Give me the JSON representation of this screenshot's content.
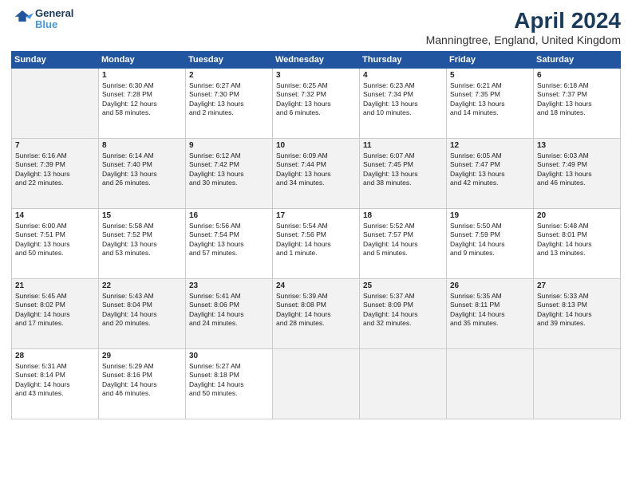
{
  "logo": {
    "line1": "General",
    "line2": "Blue"
  },
  "title": "April 2024",
  "location": "Manningtree, England, United Kingdom",
  "headers": [
    "Sunday",
    "Monday",
    "Tuesday",
    "Wednesday",
    "Thursday",
    "Friday",
    "Saturday"
  ],
  "weeks": [
    [
      {
        "day": "",
        "content": ""
      },
      {
        "day": "1",
        "content": "Sunrise: 6:30 AM\nSunset: 7:28 PM\nDaylight: 12 hours\nand 58 minutes."
      },
      {
        "day": "2",
        "content": "Sunrise: 6:27 AM\nSunset: 7:30 PM\nDaylight: 13 hours\nand 2 minutes."
      },
      {
        "day": "3",
        "content": "Sunrise: 6:25 AM\nSunset: 7:32 PM\nDaylight: 13 hours\nand 6 minutes."
      },
      {
        "day": "4",
        "content": "Sunrise: 6:23 AM\nSunset: 7:34 PM\nDaylight: 13 hours\nand 10 minutes."
      },
      {
        "day": "5",
        "content": "Sunrise: 6:21 AM\nSunset: 7:35 PM\nDaylight: 13 hours\nand 14 minutes."
      },
      {
        "day": "6",
        "content": "Sunrise: 6:18 AM\nSunset: 7:37 PM\nDaylight: 13 hours\nand 18 minutes."
      }
    ],
    [
      {
        "day": "7",
        "content": "Sunrise: 6:16 AM\nSunset: 7:39 PM\nDaylight: 13 hours\nand 22 minutes."
      },
      {
        "day": "8",
        "content": "Sunrise: 6:14 AM\nSunset: 7:40 PM\nDaylight: 13 hours\nand 26 minutes."
      },
      {
        "day": "9",
        "content": "Sunrise: 6:12 AM\nSunset: 7:42 PM\nDaylight: 13 hours\nand 30 minutes."
      },
      {
        "day": "10",
        "content": "Sunrise: 6:09 AM\nSunset: 7:44 PM\nDaylight: 13 hours\nand 34 minutes."
      },
      {
        "day": "11",
        "content": "Sunrise: 6:07 AM\nSunset: 7:45 PM\nDaylight: 13 hours\nand 38 minutes."
      },
      {
        "day": "12",
        "content": "Sunrise: 6:05 AM\nSunset: 7:47 PM\nDaylight: 13 hours\nand 42 minutes."
      },
      {
        "day": "13",
        "content": "Sunrise: 6:03 AM\nSunset: 7:49 PM\nDaylight: 13 hours\nand 46 minutes."
      }
    ],
    [
      {
        "day": "14",
        "content": "Sunrise: 6:00 AM\nSunset: 7:51 PM\nDaylight: 13 hours\nand 50 minutes."
      },
      {
        "day": "15",
        "content": "Sunrise: 5:58 AM\nSunset: 7:52 PM\nDaylight: 13 hours\nand 53 minutes."
      },
      {
        "day": "16",
        "content": "Sunrise: 5:56 AM\nSunset: 7:54 PM\nDaylight: 13 hours\nand 57 minutes."
      },
      {
        "day": "17",
        "content": "Sunrise: 5:54 AM\nSunset: 7:56 PM\nDaylight: 14 hours\nand 1 minute."
      },
      {
        "day": "18",
        "content": "Sunrise: 5:52 AM\nSunset: 7:57 PM\nDaylight: 14 hours\nand 5 minutes."
      },
      {
        "day": "19",
        "content": "Sunrise: 5:50 AM\nSunset: 7:59 PM\nDaylight: 14 hours\nand 9 minutes."
      },
      {
        "day": "20",
        "content": "Sunrise: 5:48 AM\nSunset: 8:01 PM\nDaylight: 14 hours\nand 13 minutes."
      }
    ],
    [
      {
        "day": "21",
        "content": "Sunrise: 5:45 AM\nSunset: 8:02 PM\nDaylight: 14 hours\nand 17 minutes."
      },
      {
        "day": "22",
        "content": "Sunrise: 5:43 AM\nSunset: 8:04 PM\nDaylight: 14 hours\nand 20 minutes."
      },
      {
        "day": "23",
        "content": "Sunrise: 5:41 AM\nSunset: 8:06 PM\nDaylight: 14 hours\nand 24 minutes."
      },
      {
        "day": "24",
        "content": "Sunrise: 5:39 AM\nSunset: 8:08 PM\nDaylight: 14 hours\nand 28 minutes."
      },
      {
        "day": "25",
        "content": "Sunrise: 5:37 AM\nSunset: 8:09 PM\nDaylight: 14 hours\nand 32 minutes."
      },
      {
        "day": "26",
        "content": "Sunrise: 5:35 AM\nSunset: 8:11 PM\nDaylight: 14 hours\nand 35 minutes."
      },
      {
        "day": "27",
        "content": "Sunrise: 5:33 AM\nSunset: 8:13 PM\nDaylight: 14 hours\nand 39 minutes."
      }
    ],
    [
      {
        "day": "28",
        "content": "Sunrise: 5:31 AM\nSunset: 8:14 PM\nDaylight: 14 hours\nand 43 minutes."
      },
      {
        "day": "29",
        "content": "Sunrise: 5:29 AM\nSunset: 8:16 PM\nDaylight: 14 hours\nand 46 minutes."
      },
      {
        "day": "30",
        "content": "Sunrise: 5:27 AM\nSunset: 8:18 PM\nDaylight: 14 hours\nand 50 minutes."
      },
      {
        "day": "",
        "content": ""
      },
      {
        "day": "",
        "content": ""
      },
      {
        "day": "",
        "content": ""
      },
      {
        "day": "",
        "content": ""
      }
    ]
  ]
}
